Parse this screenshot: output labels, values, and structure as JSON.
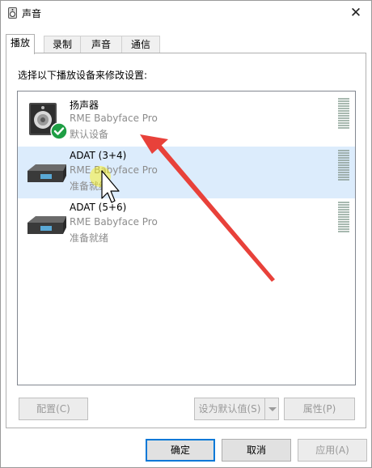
{
  "window": {
    "title": "声音",
    "close_symbol": "✕"
  },
  "tabs": [
    {
      "label": "播放",
      "active": true
    },
    {
      "label": "录制",
      "active": false
    },
    {
      "label": "声音",
      "active": false
    },
    {
      "label": "通信",
      "active": false
    }
  ],
  "instruction": "选择以下播放设备来修改设置:",
  "devices": [
    {
      "name": "扬声器",
      "description": "RME Babyface Pro",
      "status": "默认设备",
      "icon": "speaker-icon",
      "default": true,
      "selected": false
    },
    {
      "name": "ADAT (3+4)",
      "description": "RME Babyface Pro",
      "status": "准备就绪",
      "icon": "digital-output-icon",
      "default": false,
      "selected": true
    },
    {
      "name": "ADAT (5+6)",
      "description": "RME Babyface Pro",
      "status": "准备就绪",
      "icon": "digital-output-icon",
      "default": false,
      "selected": false
    }
  ],
  "panel_buttons": {
    "configure": "配置(C)",
    "set_default": "设为默认值(S)",
    "properties": "属性(P)"
  },
  "dialog_buttons": {
    "ok": "确定",
    "cancel": "取消",
    "apply": "应用(A)"
  },
  "colors": {
    "selection": "#dcecfc",
    "accent": "#0078d7",
    "annotation_arrow": "#e8413a",
    "check_badge": "#1e9e44"
  }
}
